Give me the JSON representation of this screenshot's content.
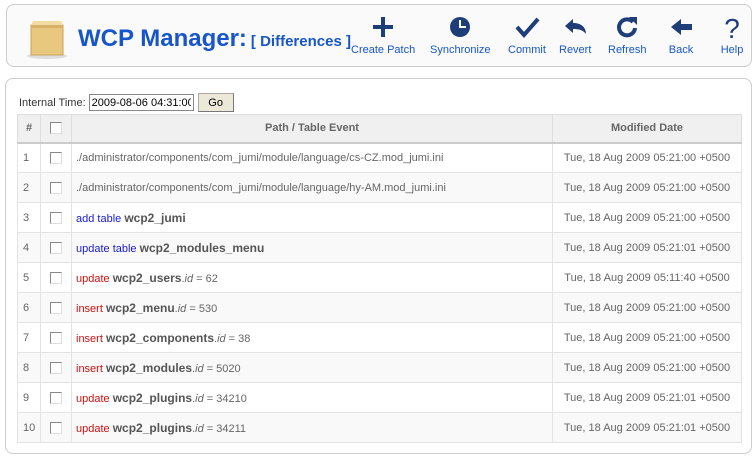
{
  "header": {
    "title": "WCP Manager:",
    "subtitle": "[ Differences ]"
  },
  "toolbar": [
    {
      "label": "Create Patch",
      "icon": "plus-icon"
    },
    {
      "label": "Synchronize",
      "icon": "clock-icon"
    },
    {
      "label": "Commit",
      "icon": "check-icon"
    },
    {
      "label": "Revert",
      "icon": "revert-arrow-icon"
    },
    {
      "label": "Refresh",
      "icon": "refresh-icon"
    },
    {
      "label": "Back",
      "icon": "back-arrow-icon"
    },
    {
      "label": "Help",
      "icon": "question-icon"
    }
  ],
  "filter": {
    "label": "Internal Time:",
    "value": "2009-08-06 04:31:00",
    "go_label": "Go"
  },
  "table": {
    "headers": {
      "num": "#",
      "path": "Path / Table Event",
      "date": "Modified Date"
    },
    "rows": [
      {
        "num": "1",
        "kind": "path",
        "text": "./administrator/components/com_jumi/module/language/cs-CZ.mod_jumi.ini",
        "date": "Tue, 18 Aug 2009 05:21:00 +0500"
      },
      {
        "num": "2",
        "kind": "path",
        "text": "./administrator/components/com_jumi/module/language/hy-AM.mod_jumi.ini",
        "date": "Tue, 18 Aug 2009 05:21:00 +0500"
      },
      {
        "num": "3",
        "kind": "table",
        "action": "add table",
        "table": "wcp2_jumi",
        "date": "Tue, 18 Aug 2009 05:21:00 +0500"
      },
      {
        "num": "4",
        "kind": "table",
        "action": "update table",
        "table": "wcp2_modules_menu",
        "date": "Tue, 18 Aug 2009 05:21:01 +0500"
      },
      {
        "num": "5",
        "kind": "record",
        "action": "update",
        "table": "wcp2_users",
        "field": "id",
        "value": " = 62",
        "date": "Tue, 18 Aug 2009 05:11:40 +0500"
      },
      {
        "num": "6",
        "kind": "record",
        "action": "insert",
        "table": "wcp2_menu",
        "field": "id",
        "value": " = 530",
        "date": "Tue, 18 Aug 2009 05:21:00 +0500"
      },
      {
        "num": "7",
        "kind": "record",
        "action": "insert",
        "table": "wcp2_components",
        "field": "id",
        "value": " = 38",
        "date": "Tue, 18 Aug 2009 05:21:00 +0500"
      },
      {
        "num": "8",
        "kind": "record",
        "action": "insert",
        "table": "wcp2_modules",
        "field": "id",
        "value": " = 5020",
        "date": "Tue, 18 Aug 2009 05:21:00 +0500"
      },
      {
        "num": "9",
        "kind": "record",
        "action": "update",
        "table": "wcp2_plugins",
        "field": "id",
        "value": " = 34210",
        "date": "Tue, 18 Aug 2009 05:21:01 +0500"
      },
      {
        "num": "10",
        "kind": "record",
        "action": "update",
        "table": "wcp2_plugins",
        "field": "id",
        "value": " = 34211",
        "date": "Tue, 18 Aug 2009 05:21:01 +0500"
      }
    ]
  }
}
